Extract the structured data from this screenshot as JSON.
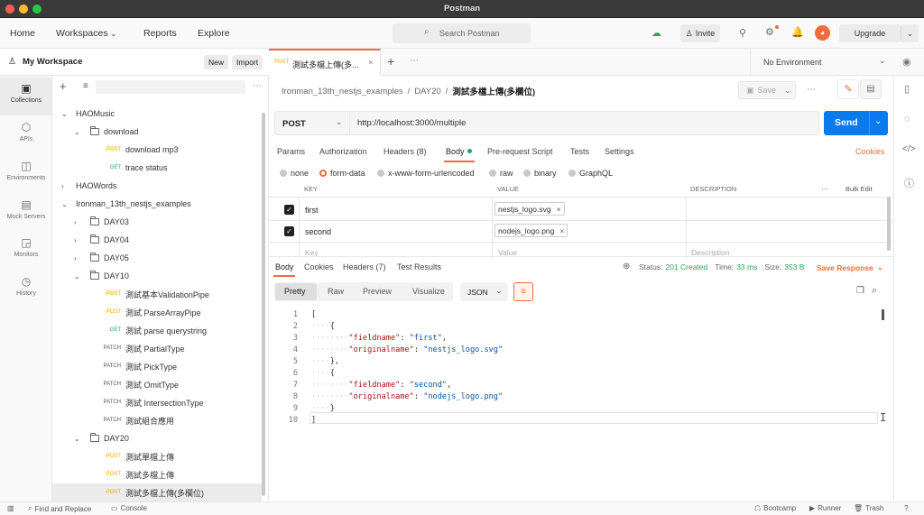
{
  "window": {
    "title": "Postman"
  },
  "nav": {
    "home": "Home",
    "workspaces": "Workspaces",
    "reports": "Reports",
    "explore": "Explore",
    "search_placeholder": "Search Postman",
    "invite": "Invite",
    "upgrade": "Upgrade"
  },
  "rail": [
    {
      "label": "Collections"
    },
    {
      "label": "APIs"
    },
    {
      "label": "Environments"
    },
    {
      "label": "Mock Servers"
    },
    {
      "label": "Monitors"
    },
    {
      "label": "History"
    }
  ],
  "workspace": {
    "name": "My Workspace",
    "new_label": "New",
    "import_label": "Import"
  },
  "tree": [
    {
      "label": "HAOMusic",
      "type": "collection",
      "depth": 0,
      "chev": "v"
    },
    {
      "label": "download",
      "type": "folder",
      "depth": 1,
      "chev": "v"
    },
    {
      "label": "download mp3",
      "type": "request",
      "method": "POST",
      "depth": 2
    },
    {
      "label": "trace status",
      "type": "request",
      "method": "GET",
      "depth": 2
    },
    {
      "label": "HAOWords",
      "type": "collection",
      "depth": 0,
      "chev": ">"
    },
    {
      "label": "Ironman_13th_nestjs_examples",
      "type": "collection",
      "depth": 0,
      "chev": "v"
    },
    {
      "label": "DAY03",
      "type": "folder",
      "depth": 1,
      "chev": ">"
    },
    {
      "label": "DAY04",
      "type": "folder",
      "depth": 1,
      "chev": ">"
    },
    {
      "label": "DAY05",
      "type": "folder",
      "depth": 1,
      "chev": ">"
    },
    {
      "label": "DAY10",
      "type": "folder",
      "depth": 1,
      "chev": "v"
    },
    {
      "label": "測試基本ValidationPipe",
      "type": "request",
      "method": "POST",
      "depth": 2
    },
    {
      "label": "測試 ParseArrayPipe",
      "type": "request",
      "method": "POST",
      "depth": 2
    },
    {
      "label": "測試 parse querystring",
      "type": "request",
      "method": "GET",
      "depth": 2
    },
    {
      "label": "測試 PartialType",
      "type": "request",
      "method": "PATCH",
      "depth": 2
    },
    {
      "label": "測試 PickType",
      "type": "request",
      "method": "PATCH",
      "depth": 2
    },
    {
      "label": "測試 OmitType",
      "type": "request",
      "method": "PATCH",
      "depth": 2
    },
    {
      "label": "測試 IntersectionType",
      "type": "request",
      "method": "PATCH",
      "depth": 2
    },
    {
      "label": "測試組合應用",
      "type": "request",
      "method": "PATCH",
      "depth": 2
    },
    {
      "label": "DAY20",
      "type": "folder",
      "depth": 1,
      "chev": "v"
    },
    {
      "label": "測試單檔上傳",
      "type": "request",
      "method": "POST",
      "depth": 2
    },
    {
      "label": "測試多檔上傳",
      "type": "request",
      "method": "POST",
      "depth": 2
    },
    {
      "label": "測試多檔上傳(多欄位)",
      "type": "request",
      "method": "POST",
      "depth": 2,
      "selected": true
    }
  ],
  "tab": {
    "method": "POST",
    "title": "測試多檔上傳(多..."
  },
  "env": {
    "label": "No Environment"
  },
  "breadcrumb": {
    "collection": "Ironman_13th_nestjs_examples",
    "folder": "DAY20",
    "request": "測試多檔上傳(多欄位)",
    "save": "Save"
  },
  "request": {
    "method": "POST",
    "url": "http://localhost:3000/multiple",
    "send": "Send"
  },
  "req_tabs": [
    {
      "label": "Params"
    },
    {
      "label": "Authorization"
    },
    {
      "label": "Headers (8)"
    },
    {
      "label": "Body"
    },
    {
      "label": "Pre-request Script"
    },
    {
      "label": "Tests"
    },
    {
      "label": "Settings"
    }
  ],
  "cookies_label": "Cookies",
  "body_options": [
    "none",
    "form-data",
    "x-www-form-urlencoded",
    "raw",
    "binary",
    "GraphQL"
  ],
  "form": {
    "columns": {
      "key": "KEY",
      "value": "VALUE",
      "description": "DESCRIPTION",
      "bulk_edit": "Bulk Edit"
    },
    "rows": [
      {
        "key": "first",
        "value": "nestjs_logo.svg"
      },
      {
        "key": "second",
        "value": "nodejs_logo.png"
      }
    ],
    "placeholder": {
      "key": "Key",
      "value": "Value",
      "description": "Description"
    }
  },
  "response": {
    "tabs": [
      {
        "label": "Body"
      },
      {
        "label": "Cookies"
      },
      {
        "label": "Headers (7)"
      },
      {
        "label": "Test Results"
      }
    ],
    "status_label": "Status:",
    "status": "201 Created",
    "time_label": "Time:",
    "time": "33 ms",
    "size_label": "Size:",
    "size": "353 B",
    "save_response": "Save Response",
    "views": [
      "Pretty",
      "Raw",
      "Preview",
      "Visualize"
    ],
    "format": "JSON",
    "lines": [
      {
        "n": "1",
        "t": "["
      },
      {
        "n": "2",
        "t": "{"
      },
      {
        "n": "3",
        "k": "\"fieldname\"",
        "v": "\"first\"",
        "end": ","
      },
      {
        "n": "4",
        "k": "\"originalname\"",
        "v": "\"nestjs_logo.svg\"",
        "end": ""
      },
      {
        "n": "5",
        "t": "},"
      },
      {
        "n": "6",
        "t": "{"
      },
      {
        "n": "7",
        "k": "\"fieldname\"",
        "v": "\"second\"",
        "end": ","
      },
      {
        "n": "8",
        "k": "\"originalname\"",
        "v": "\"nodejs_logo.png\"",
        "end": ""
      },
      {
        "n": "9",
        "t": "}"
      },
      {
        "n": "10",
        "t": "]"
      }
    ]
  },
  "footer": {
    "find_replace": "Find and Replace",
    "console": "Console",
    "bootcamp": "Bootcamp",
    "runner": "Runner",
    "trash": "Trash"
  }
}
